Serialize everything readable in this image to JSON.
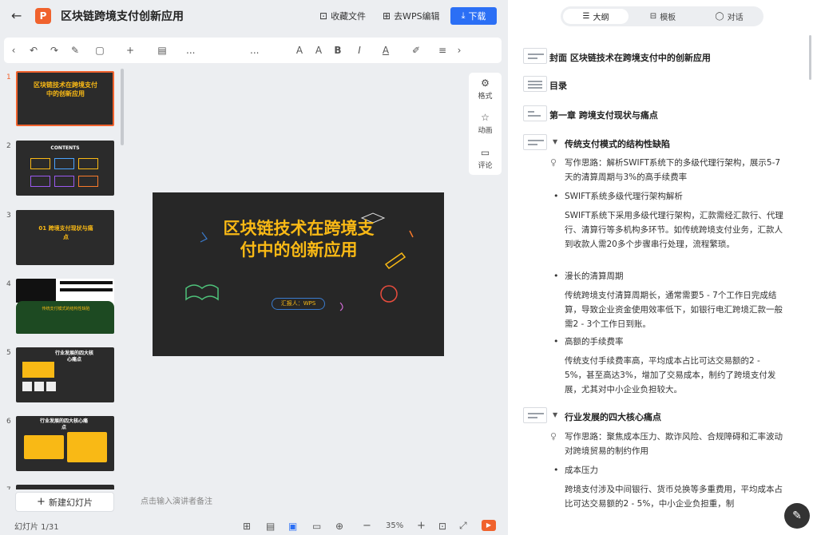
{
  "header": {
    "back_icon": "arrow-left-icon",
    "app_badge": "P",
    "title": "区块链跨境支付创新应用",
    "collect_label": "收藏文件",
    "wps_label": "去WPS编辑",
    "download_label": "下载"
  },
  "toolbar": {
    "items": [
      "‹",
      "↶",
      "↷",
      "✎",
      "▢",
      "+",
      "▤",
      "...",
      "...",
      "A",
      "A",
      "B",
      "I",
      "A",
      "✐",
      "≡",
      "›"
    ]
  },
  "thumbnails": [
    {
      "num": "1",
      "text": "区块链技术在跨境支付中的创新应用"
    },
    {
      "num": "2",
      "text": "CONTENTS"
    },
    {
      "num": "3",
      "text": "01 跨境支付现状与痛点"
    },
    {
      "num": "4",
      "text": "传统支付模式的结构性缺陷"
    },
    {
      "num": "5",
      "text": "行业发展的四大核心痛点"
    },
    {
      "num": "6",
      "text": "行业发展的四大核心痛点"
    },
    {
      "num": "7",
      "text": ""
    }
  ],
  "new_slide_label": "新建幻灯片",
  "slide": {
    "title": "区块链技术在跨境支付中的创新应用",
    "presenter": "汇报人：WPS"
  },
  "side_tools": [
    {
      "label": "格式",
      "icon": "gear-icon"
    },
    {
      "label": "动画",
      "icon": "star-icon"
    },
    {
      "label": "评论",
      "icon": "comment-icon"
    }
  ],
  "notes_placeholder": "点击输入演讲者备注",
  "status": {
    "slide_count": "幻灯片 1/31",
    "zoom": "35%"
  },
  "right_tabs": [
    {
      "label": "大纲",
      "icon": "list-icon"
    },
    {
      "label": "模板",
      "icon": "template-icon"
    },
    {
      "label": "对话",
      "icon": "chat-icon"
    }
  ],
  "outline": {
    "cover": "封面 区块链技术在跨境支付中的创新应用",
    "toc": "目录",
    "chapter": "第一章 跨境支付现状与痛点",
    "section1": "传统支付模式的结构性缺陷",
    "idea1": "写作思路：解析SWIFT系统下的多级代理行架构，展示5-7天的清算周期与3%的高手续费率",
    "b1": "SWIFT系统多级代理行架构解析",
    "p1": "SWIFT系统下采用多级代理行架构，汇款需经汇款行、代理行、清算行等多机构多环节。如传统跨境支付业务，汇款人到收款人需20多个步骤串行处理，流程繁琐。",
    "b2": "漫长的清算周期",
    "p2": "传统跨境支付清算周期长，通常需要5 - 7个工作日完成结算，导致企业资金使用效率低下，如银行电汇跨境汇款一般需2 - 3个工作日到账。",
    "b3": "高额的手续费率",
    "p3": "传统支付手续费率高，平均成本占比可达交易额的2 - 5%，甚至高达3%，增加了交易成本，制约了跨境支付发展，尤其对中小企业负担较大。",
    "section2": "行业发展的四大核心痛点",
    "idea2": "写作思路：聚焦成本压力、欺诈风险、合规障碍和汇率波动对跨境贸易的制约作用",
    "b4": "成本压力",
    "p4": "跨境支付涉及中间银行、货币兑换等多重费用，平均成本占比可达交易额的2 - 5%，中小企业负担重，制"
  }
}
